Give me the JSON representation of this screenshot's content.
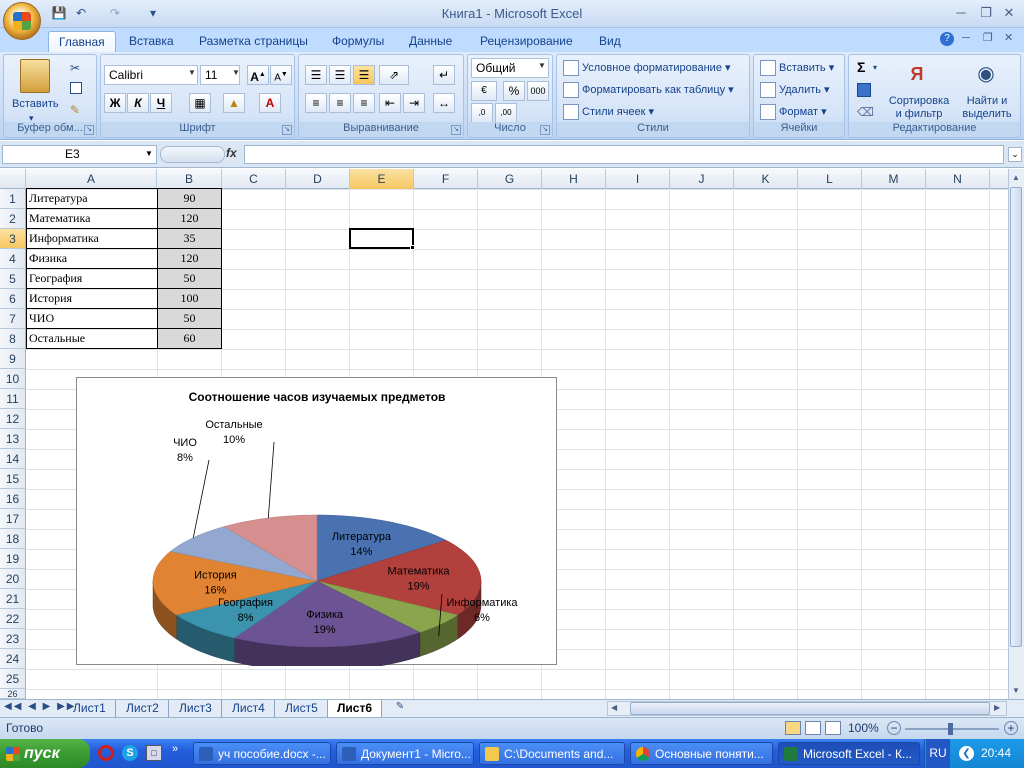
{
  "window": {
    "title": "Книга1 - Microsoft Excel"
  },
  "tabs": [
    "Главная",
    "Вставка",
    "Разметка страницы",
    "Формулы",
    "Данные",
    "Рецензирование",
    "Вид"
  ],
  "ribbon": {
    "clipboard": {
      "paste": "Вставить",
      "label": "Буфер обм..."
    },
    "font": {
      "name": "Calibri",
      "size": "11",
      "bold": "Ж",
      "italic": "К",
      "underline": "Ч",
      "label": "Шрифт"
    },
    "alignment": {
      "label": "Выравнивание"
    },
    "number": {
      "format": "Общий",
      "percent": "%",
      "thousands": "000",
      "label": "Число"
    },
    "styles": {
      "conditional": "Условное форматирование",
      "as_table": "Форматировать как таблицу",
      "cell_styles": "Стили ячеек",
      "label": "Стили"
    },
    "cells": {
      "insert": "Вставить",
      "delete": "Удалить",
      "format": "Формат",
      "label": "Ячейки"
    },
    "editing": {
      "sigma": "Σ",
      "sort": "Сортировка и фильтр",
      "find": "Найти и выделить",
      "label": "Редактирование"
    }
  },
  "formula_bar": {
    "name_box": "E3",
    "fx": "fx",
    "value": ""
  },
  "columns": [
    "A",
    "B",
    "C",
    "D",
    "E",
    "F",
    "G",
    "H",
    "I",
    "J",
    "K",
    "L",
    "M",
    "N"
  ],
  "rows": [
    "1",
    "2",
    "3",
    "4",
    "5",
    "6",
    "7",
    "8",
    "9",
    "10",
    "11",
    "12",
    "13",
    "14",
    "15",
    "16",
    "17",
    "18",
    "19",
    "20",
    "21",
    "22",
    "23",
    "24",
    "25",
    "26"
  ],
  "table": [
    {
      "subject": "Литература",
      "hours": "90"
    },
    {
      "subject": "Математика",
      "hours": "120"
    },
    {
      "subject": "Информатика",
      "hours": "35"
    },
    {
      "subject": "Физика",
      "hours": "120"
    },
    {
      "subject": "География",
      "hours": "50"
    },
    {
      "subject": "История",
      "hours": "100"
    },
    {
      "subject": "ЧИО",
      "hours": "50"
    },
    {
      "subject": "Остальные",
      "hours": "60"
    }
  ],
  "chart_data": {
    "type": "pie",
    "title": "Соотношение часов изучаемых предметов",
    "categories": [
      "Литература",
      "Математика",
      "Информатика",
      "Физика",
      "География",
      "История",
      "ЧИО",
      "Остальные"
    ],
    "values": [
      90,
      120,
      35,
      120,
      50,
      100,
      50,
      60
    ],
    "percent_labels": [
      "14%",
      "19%",
      "6%",
      "19%",
      "8%",
      "16%",
      "8%",
      "10%"
    ],
    "colors": [
      "#4a72b0",
      "#b2403d",
      "#8ba54c",
      "#6c5393",
      "#3b93ae",
      "#e08434",
      "#93a8d0",
      "#d58f8f"
    ],
    "style": "3d"
  },
  "sheets": [
    "Лист1",
    "Лист2",
    "Лист3",
    "Лист4",
    "Лист5",
    "Лист6"
  ],
  "active_sheet": "Лист6",
  "status": {
    "ready": "Готово",
    "zoom": "100%"
  },
  "taskbar": {
    "start": "пуск",
    "tasks": [
      "уч пособие.docx -...",
      "Документ1 - Micro...",
      "C:\\Documents and...",
      "Основные поняти...",
      "Microsoft Excel - К..."
    ],
    "lang": "RU",
    "clock": "20:44"
  }
}
